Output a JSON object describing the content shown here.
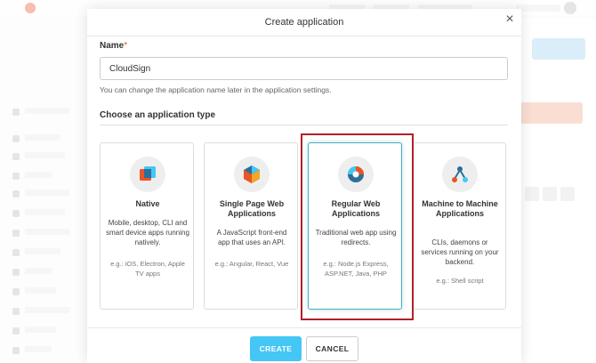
{
  "modal": {
    "title": "Create application",
    "close_glyph": "×",
    "name_label": "Name",
    "required_mark": "*",
    "name_value": "CloudSign",
    "name_help": "You can change the application name later in the application settings.",
    "type_heading": "Choose an application type",
    "cards": [
      {
        "title": "Native",
        "description": "Mobile, desktop, CLI and smart device apps running natively.",
        "examples": "e.g.: iOS, Electron, Apple TV apps",
        "icon": "native-app-icon"
      },
      {
        "title": "Single Page Web Applications",
        "description": "A JavaScript front-end app that uses an API.",
        "examples": "e.g.: Angular, React, Vue",
        "icon": "spa-icon"
      },
      {
        "title": "Regular Web Applications",
        "description": "Traditional web app using redirects.",
        "examples": "e.g.: Node.js Express, ASP.NET, Java, PHP",
        "icon": "regular-web-app-icon",
        "selected": true
      },
      {
        "title": "Machine to Machine Applications",
        "description": "CLIs, daemons or services running on your backend.",
        "examples": "e.g.: Shell script",
        "icon": "machine-to-machine-icon"
      }
    ],
    "create_label": "CREATE",
    "cancel_label": "CANCEL"
  },
  "colors": {
    "accent": "#44c7f4",
    "selected_border": "#44b0c2",
    "highlight": "#b12028",
    "brand": "#eb5424"
  }
}
